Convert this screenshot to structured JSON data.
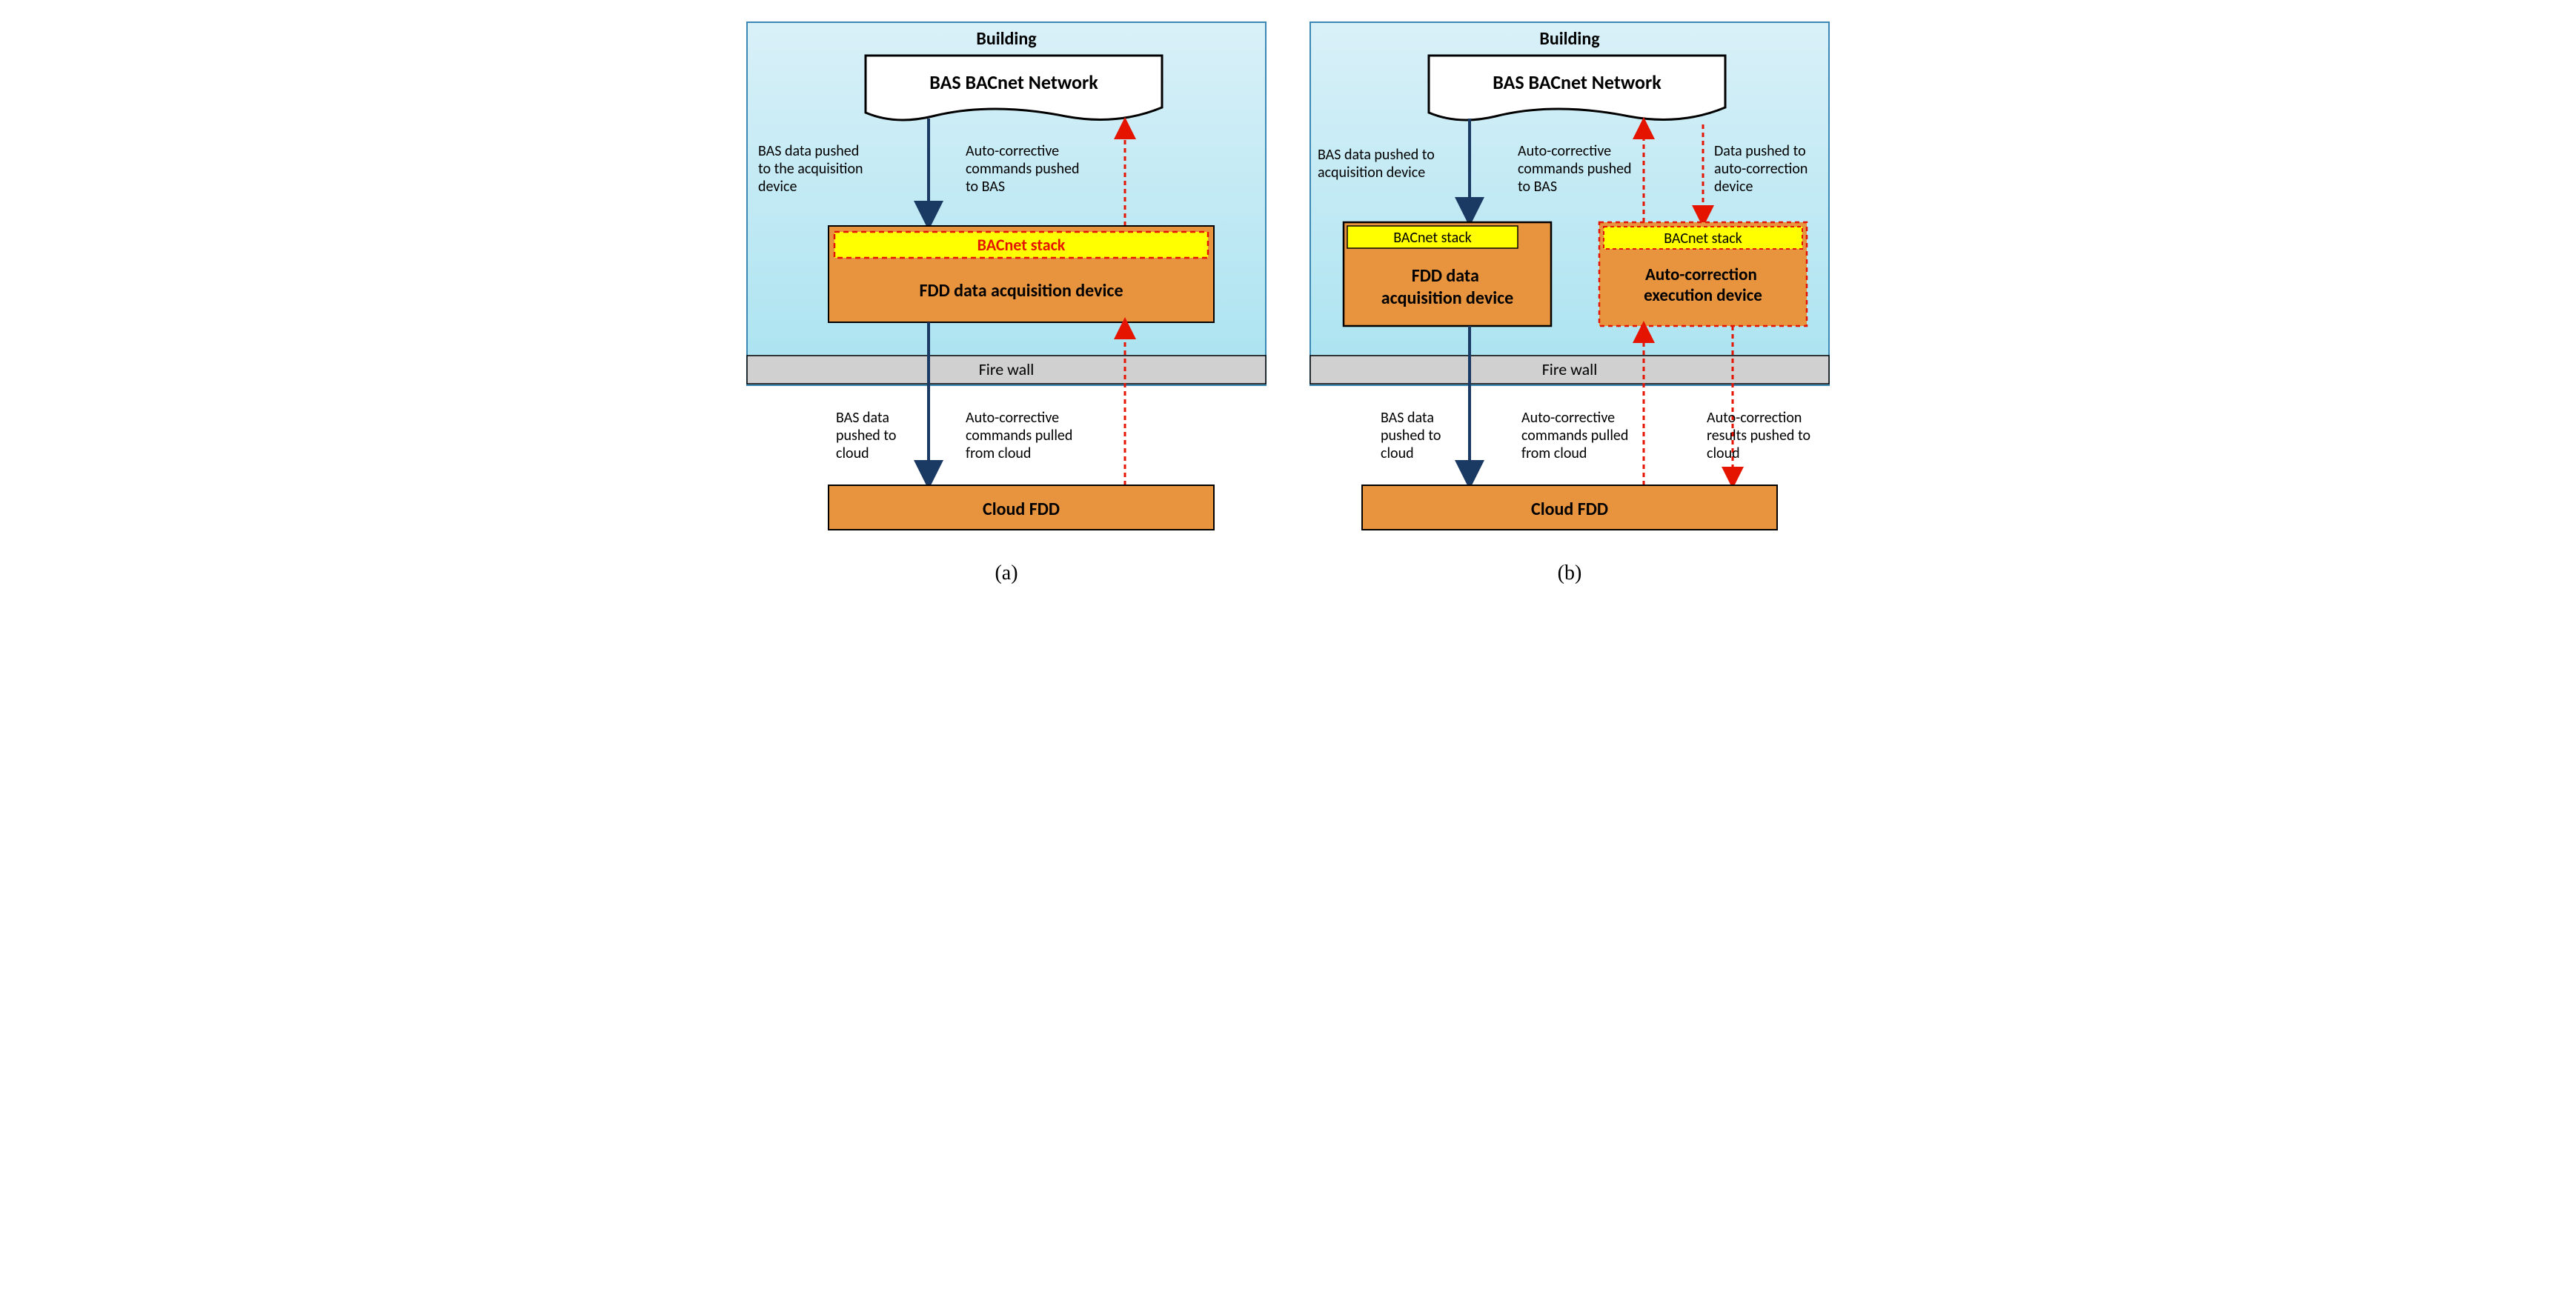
{
  "panelA": {
    "building": "Building",
    "network": "BAS BACnet Network",
    "bacnetStack": "BACnet stack",
    "fddDevice": "FDD data acquisition device",
    "firewall": "Fire wall",
    "cloud": "Cloud FDD",
    "txt_basAcq": [
      "BAS data pushed",
      "to the acquisition",
      "device"
    ],
    "txt_cmdBas": [
      "Auto-corrective",
      "commands pushed",
      "to BAS"
    ],
    "txt_basCloud": [
      "BAS data",
      "pushed to",
      "cloud"
    ],
    "txt_cmdCloud": [
      "Auto-corrective",
      "commands pulled",
      "from cloud"
    ],
    "caption": "(a)"
  },
  "panelB": {
    "building": "Building",
    "network": "BAS BACnet Network",
    "bacnetStack": "BACnet stack",
    "fddDevice": [
      "FDD data",
      "acquisition  device"
    ],
    "execDevice": [
      "Auto-correction",
      "execution device"
    ],
    "firewall": "Fire wall",
    "cloud": "Cloud FDD",
    "txt_basAcq": [
      "BAS data pushed to",
      "acquisition device"
    ],
    "txt_cmdBas": [
      "Auto-corrective",
      "commands pushed",
      "to BAS"
    ],
    "txt_pushExec": [
      "Data pushed to",
      "auto-correction",
      "device"
    ],
    "txt_basCloud": [
      "BAS data",
      "pushed to",
      "cloud"
    ],
    "txt_cmdCloud": [
      "Auto-corrective",
      "commands pulled",
      "from cloud"
    ],
    "txt_resCloud": [
      "Auto-correction",
      "results pushed to",
      "cloud"
    ],
    "caption": "(b)"
  }
}
